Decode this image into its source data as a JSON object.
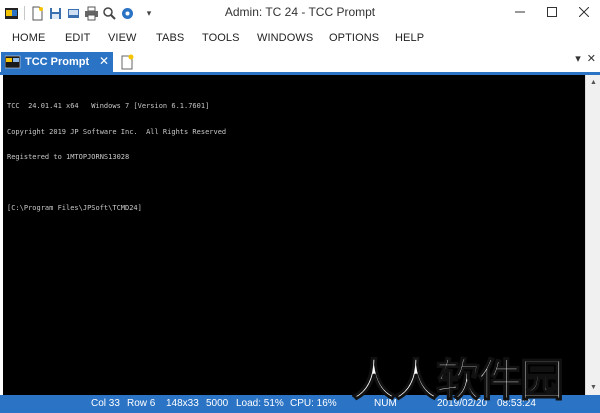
{
  "window": {
    "title": "Admin: TC 24 - TCC Prompt",
    "qat_icons": [
      "app-icon",
      "new-file-icon",
      "save-icon",
      "copy-icon",
      "print-icon",
      "zoom-icon",
      "settings-icon"
    ],
    "qat_dropdown": "▾",
    "minimize": "—",
    "maximize": "☐",
    "close": "✕"
  },
  "menu": [
    "HOME",
    "EDIT",
    "VIEW",
    "TABS",
    "TOOLS",
    "WINDOWS",
    "OPTIONS",
    "HELP"
  ],
  "tabs": [
    {
      "label": "TCC Prompt",
      "close": "✕",
      "active": true
    }
  ],
  "tabbar_right": {
    "dropdown": "▾",
    "close": "✕"
  },
  "console": {
    "lines": [
      "TCC  24.01.41 x64   Windows 7 [Version 6.1.7601]",
      "Copyright 2019 JP Software Inc.  All Rights Reserved",
      "Registered to 1MTOPJORNS13028",
      "",
      "[C:\\Program Files\\JPSoft\\TCMD24]"
    ]
  },
  "status": {
    "col": "Col 33",
    "row": "Row 6",
    "size": "148x33",
    "count": "5000",
    "load": "Load: 51%",
    "cpu": "CPU: 16%",
    "num": "NUM",
    "date": "2019/02/20",
    "time": "08:53:24"
  },
  "watermark": "人人软件园",
  "colors": {
    "accent": "#2b73c4",
    "console_bg": "#000000",
    "console_fg": "#c8c8c8"
  }
}
